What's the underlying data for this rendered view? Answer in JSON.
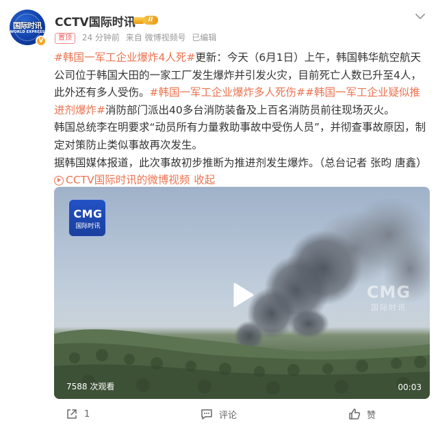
{
  "account": {
    "name": "CCTV国际时讯",
    "level": "II",
    "avatar_text": "国际时讯",
    "avatar_sub": "WORLD EXPRESS",
    "verified_mark": "V"
  },
  "meta": {
    "top_tag": "置顶",
    "time": "24 分钟前",
    "source": "来自 微博视频号",
    "edited": "已编辑"
  },
  "post": {
    "tag1": "#韩国一军工企业爆炸4人死#",
    "p1_text": "更新：今天（6月1日）上午，韩国韩华航空航天公司位于韩国大田的一家工厂发生爆炸并引发火灾，目前死亡人数已升至4人，此外还有多人受伤。",
    "tag2": "#韩国一军工企业爆炸多人死伤#",
    "tag3": "#韩国一军工企业疑似推进剂爆炸#",
    "p1_tail": "消防部门派出40多台消防装备及上百名消防员前往现场灭火。",
    "p2": "韩国总统李在明要求“动员所有力量救助事故中受伤人员”，并彻查事故原因，制定对策防止类似事故再次发生。",
    "p3": "据韩国媒体报道，此次事故初步推断为推进剂发生爆炸。（总台记者 张昀 唐鑫）",
    "video_link": "CCTV国际时讯的微博视频",
    "collapse": "收起"
  },
  "video": {
    "logo_top": "CMG",
    "logo_bottom": "国际时讯",
    "watermark_top": "CMG",
    "watermark_bottom": "国际时讯",
    "views": "7588 次观看",
    "duration": "00:03"
  },
  "actions": {
    "share_count": "1",
    "comment_label": "评论",
    "like_label": "赞"
  },
  "colors": {
    "accent": "#eb7350",
    "meta": "#999999",
    "text": "#333333"
  },
  "icons": [
    "more-icon",
    "play-circle-icon",
    "play-button-icon",
    "share-icon",
    "comment-icon",
    "like-icon"
  ]
}
